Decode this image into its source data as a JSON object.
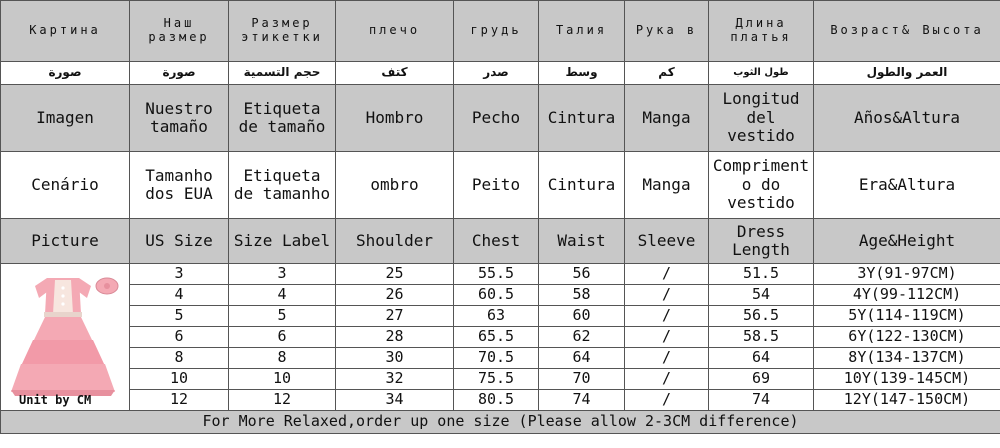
{
  "rows": {
    "russian": [
      "Картина",
      "Наш размер",
      "Размер этикетки",
      "плечо",
      "грудь",
      "Талия",
      "Рука в",
      "Длина платья",
      "Возраст& Высота"
    ],
    "arabic": [
      "صورة",
      "صورة",
      "حجم التسمية",
      "كتف",
      "صدر",
      "وسط",
      "كم",
      "طول الثوب",
      "العمر والطول"
    ],
    "spanish": [
      "Imagen",
      "Nuestro tamaño",
      "Etiqueta de tamaño",
      "Hombro",
      "Pecho",
      "Cintura",
      "Manga",
      "Longitud del vestido",
      "Años&Altura"
    ],
    "portuguese": [
      "Cenário",
      "Tamanho dos EUA",
      "Etiqueta de tamanho",
      "ombro",
      "Peito",
      "Cintura",
      "Manga",
      "Compriment o do vestido",
      "Era&Altura"
    ],
    "english": [
      "Picture",
      "US Size",
      "Size Label",
      "Shoulder",
      "Chest",
      "Waist",
      "Sleeve",
      "Dress Length",
      "Age&Height"
    ]
  },
  "unit_label": "Unit by CM",
  "data_rows": [
    [
      "3",
      "3",
      "25",
      "55.5",
      "56",
      "/",
      "51.5",
      "3Y(91-97CM)"
    ],
    [
      "4",
      "4",
      "26",
      "60.5",
      "58",
      "/",
      "54",
      "4Y(99-112CM)"
    ],
    [
      "5",
      "5",
      "27",
      "63",
      "60",
      "/",
      "56.5",
      "5Y(114-119CM)"
    ],
    [
      "6",
      "6",
      "28",
      "65.5",
      "62",
      "/",
      "58.5",
      "6Y(122-130CM)"
    ],
    [
      "8",
      "8",
      "30",
      "70.5",
      "64",
      "/",
      "64",
      "8Y(134-137CM)"
    ],
    [
      "10",
      "10",
      "32",
      "75.5",
      "70",
      "/",
      "69",
      "10Y(139-145CM)"
    ],
    [
      "12",
      "12",
      "34",
      "80.5",
      "74",
      "/",
      "74",
      "12Y(147-150CM)"
    ]
  ],
  "footer": "For More Relaxed,order up one size (Please allow 2-3CM difference)",
  "colors": {
    "header_gray": "#c8c8c8",
    "dress_pink": "#f4a9b4",
    "dress_lace": "#f7e6df"
  }
}
